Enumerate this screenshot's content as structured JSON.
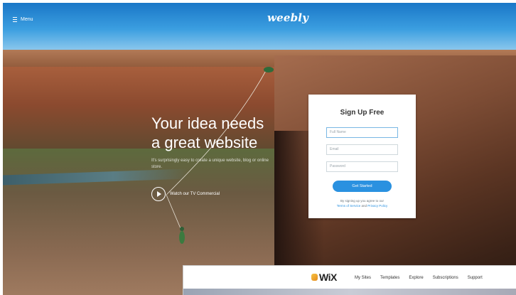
{
  "weebly": {
    "menu_label": "Menu",
    "logo_text": "weebly",
    "hero": {
      "headline_line1": "Your idea needs",
      "headline_line2": "a great website",
      "subtext": "It's surprisingly easy to create a unique website, blog or online store.",
      "video_link": "Watch our TV Commercial"
    },
    "signup": {
      "title": "Sign Up Free",
      "name_placeholder": "Full Name",
      "email_placeholder": "Email",
      "password_placeholder": "Password",
      "cta_label": "Get Started",
      "terms_prefix": "By signing up you agree to our",
      "terms_link": "Terms of Service",
      "terms_joiner": "and",
      "privacy_link": "Privacy Policy"
    }
  },
  "wix": {
    "logo_text": "WiX",
    "nav": [
      "My Sites",
      "Templates",
      "Explore",
      "Subscriptions",
      "Support"
    ]
  },
  "colors": {
    "accent_blue": "#2a91e0",
    "sky": "#3b9ee0",
    "rock": "#7e4d35",
    "wix_gold": "#f6c341"
  }
}
